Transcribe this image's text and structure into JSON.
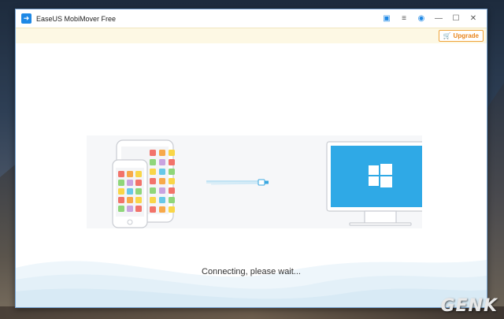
{
  "window": {
    "title": "EaseUS MobiMover Free",
    "logo_icon": "arrow-right-icon",
    "controls": [
      {
        "name": "feedback-icon",
        "glyph": "▣"
      },
      {
        "name": "menu-icon",
        "glyph": "≡"
      },
      {
        "name": "help-icon",
        "glyph": "◉"
      },
      {
        "name": "minimize-icon",
        "glyph": "—"
      },
      {
        "name": "maximize-icon",
        "glyph": "☐"
      },
      {
        "name": "close-icon",
        "glyph": "✕"
      }
    ]
  },
  "toolbar": {
    "upgrade_label": "Upgrade",
    "upgrade_icon": "cart-icon"
  },
  "main": {
    "status_text": "Connecting, please wait..."
  },
  "watermark": "GENK",
  "colors": {
    "accent": "#1e88e5",
    "upgrade": "#e8841c",
    "windows_blue": "#2fa9e6",
    "app_grid": [
      "#f2736a",
      "#f7a94a",
      "#f9d648",
      "#67c8e8",
      "#8fd67a",
      "#c9a3e0"
    ]
  }
}
